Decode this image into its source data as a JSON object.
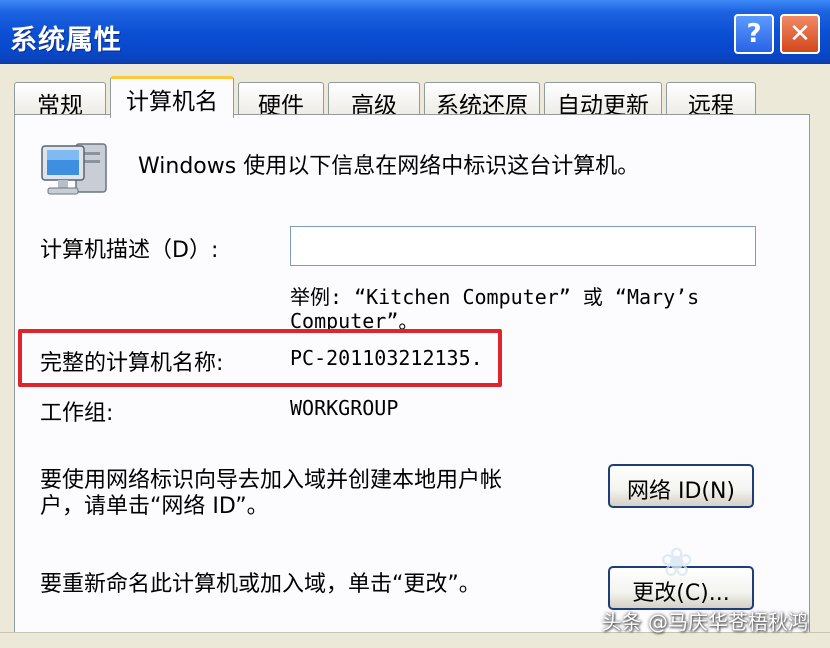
{
  "window": {
    "title": "系统属性",
    "help_glyph": "?",
    "close_glyph": "✕"
  },
  "tabs": [
    {
      "label": "常规"
    },
    {
      "label": "计算机名",
      "active": true
    },
    {
      "label": "硬件"
    },
    {
      "label": "高级"
    },
    {
      "label": "系统还原"
    },
    {
      "label": "自动更新"
    },
    {
      "label": "远程"
    }
  ],
  "panel": {
    "intro_text": "Windows 使用以下信息在网络中标识这台计算机。",
    "description_label": "计算机描述（D）:",
    "description_value": "",
    "example_line1": "举例: “Kitchen Computer” 或 “Mary’s",
    "example_line2": "Computer”。",
    "full_name_label": "完整的计算机名称:",
    "full_name_value": "PC-201103212135.",
    "workgroup_label": "工作组:",
    "workgroup_value": "WORKGROUP",
    "network_id_text_line1": "要使用网络标识向导去加入域并创建本地用户帐",
    "network_id_text_line2": "户，请单击“网络 ID”。",
    "network_id_button": "网络 ID(N)",
    "rename_text": "要重新命名此计算机或加入域，单击“更改”。",
    "change_button": "更改(C)..."
  },
  "watermark": {
    "text": "头条 @马庆华苍梧秋鸿"
  },
  "colors": {
    "title_bar": "#0a4fd4",
    "highlight_border": "#e0242c",
    "active_tab_accent": "#ffc83c"
  }
}
